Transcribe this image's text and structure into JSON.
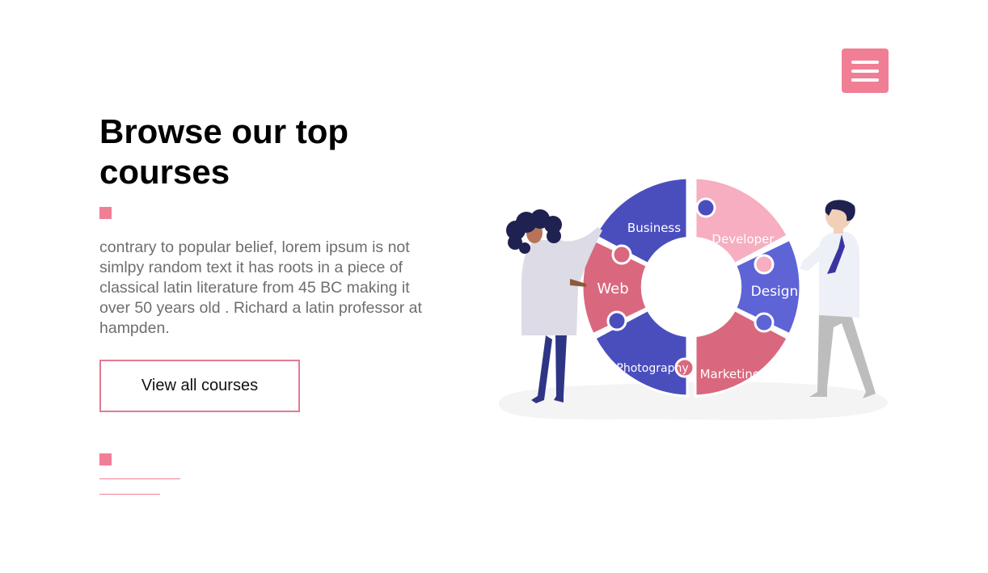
{
  "header": {
    "menu_icon": "hamburger-menu-icon"
  },
  "hero": {
    "title": "Browse our top courses",
    "description": "contrary to popular belief, lorem ipsum is not simlpy random text it has roots in a piece of classical latin literature from 45 BC making it over 50 years old . Richard a latin professor at hampden.",
    "cta_label": "View all courses"
  },
  "illustration": {
    "segments": {
      "business": "Business",
      "developer": "Developer",
      "design": "Design",
      "marketing": "Marketing",
      "photography": "Photography",
      "web": "Web"
    }
  },
  "colors": {
    "accent": "#f07f95",
    "button_border": "#e37a93",
    "indigo": "#4a4ebd",
    "indigo_light": "#5e63d6",
    "pink_dark": "#d9687f",
    "pink_light": "#f6aec0"
  }
}
